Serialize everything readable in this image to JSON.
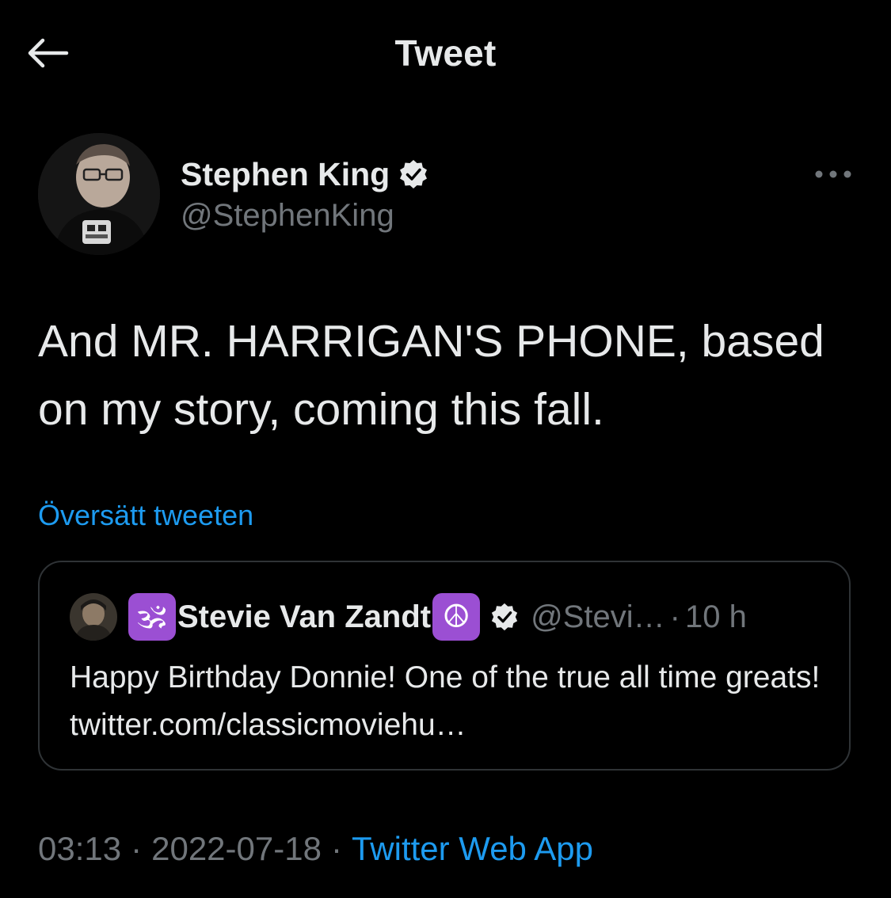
{
  "header": {
    "title": "Tweet",
    "back_icon": "arrow-left-icon"
  },
  "tweet": {
    "author": {
      "name": "Stephen King",
      "handle": "@StephenKing",
      "verified_icon": "verified-badge-icon"
    },
    "more_icon": "more-dots-icon",
    "text": "And MR. HARRIGAN'S PHONE, based on my story, coming this fall.",
    "translate_label": "Översätt tweeten",
    "quoted": {
      "name_prefix_emoji": "🕉",
      "name": "Stevie Van Zandt",
      "name_suffix_emoji": "☮",
      "handle": "@Stevi…",
      "dot": "·",
      "time": "10 h",
      "text": "Happy Birthday Donnie! One of the true all time greats! twitter.com/classicmoviehu…"
    },
    "meta": {
      "time": "03:13",
      "sep1": "·",
      "date": "2022-07-18",
      "sep2": "·",
      "source": "Twitter Web App"
    }
  },
  "colors": {
    "background": "#000000",
    "text": "#e7e9ea",
    "secondary": "#71767b",
    "accent": "#1d9bf0",
    "border": "#2f3336"
  }
}
